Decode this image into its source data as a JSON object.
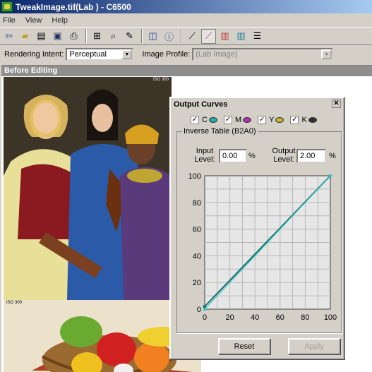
{
  "window": {
    "title": "TweakImage.tif(Lab ) - C6500"
  },
  "menu": [
    "File",
    "View",
    "Help"
  ],
  "options": {
    "rendering_intent_label": "Rendering Intent:",
    "rendering_intent_value": "Perceptual",
    "image_profile_label": "Image Profile:",
    "image_profile_value": "(Lab Image)"
  },
  "document": {
    "pane_title": "Before Editing",
    "iso_top": "ISO 300",
    "iso_bottom": "ISO 300"
  },
  "dialog": {
    "title": "Output Curves",
    "close": "✕",
    "channels": [
      {
        "label": "C",
        "color": "#20b0a8",
        "checked": true
      },
      {
        "label": "M",
        "color": "#b030b0",
        "checked": true
      },
      {
        "label": "Y",
        "color": "#c8b830",
        "checked": true
      },
      {
        "label": "K",
        "color": "#303030",
        "checked": true
      }
    ],
    "group_label": "Inverse Table (B2A0)",
    "input_label": "Input\nLevel:",
    "input_value": "0.00",
    "output_label": "Output\nLevel:",
    "output_value": "2.00",
    "pct": "%",
    "reset": "Reset",
    "apply": "Apply"
  },
  "chart_data": {
    "type": "line",
    "xlim": [
      0,
      100
    ],
    "ylim": [
      0,
      100
    ],
    "xticks": [
      "0",
      "20",
      "40",
      "60",
      "80",
      "100"
    ],
    "yticks": [
      "0",
      "20",
      "40",
      "60",
      "80",
      "100"
    ],
    "grid": true,
    "series": [
      {
        "color": "#1a6a6a",
        "x": [
          0,
          100
        ],
        "y": [
          2,
          100
        ]
      },
      {
        "color": "#30c8c0",
        "x": [
          0,
          100
        ],
        "y": [
          0,
          100
        ]
      }
    ]
  }
}
